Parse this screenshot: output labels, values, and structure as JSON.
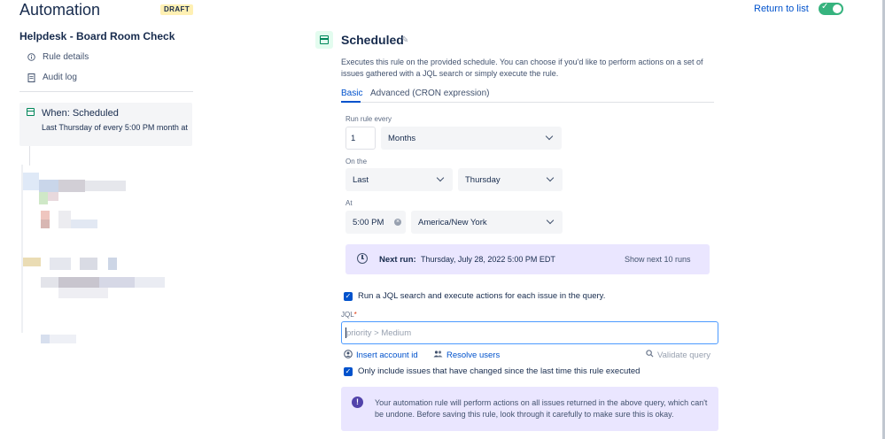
{
  "header": {
    "app_title": "Automation",
    "draft_badge": "DRAFT",
    "return_link": "Return to list",
    "toggle_state": "enabled"
  },
  "sidebar": {
    "rule_name": "Helpdesk - Board Room Check",
    "links": [
      {
        "label": "Rule details",
        "icon": "info-icon"
      },
      {
        "label": "Audit log",
        "icon": "document-icon"
      }
    ],
    "trigger": {
      "title": "When: Scheduled",
      "description": "Last Thursday of every 5:00 PM month at"
    }
  },
  "main": {
    "title": "Scheduled",
    "description": "Executes this rule on the provided schedule. You can choose if you'd like to perform actions on a set of issues gathered with a JQL search or simply execute the rule.",
    "tabs": [
      {
        "label": "Basic",
        "active": true
      },
      {
        "label": "Advanced (CRON expression)",
        "active": false
      }
    ],
    "schedule": {
      "run_every_label": "Run rule every",
      "run_every_value": "1",
      "run_every_unit": "Months",
      "on_the_label": "On the",
      "on_the_ordinal": "Last",
      "on_the_day": "Thursday",
      "at_label": "At",
      "at_time": "5:00 PM",
      "timezone": "America/New York"
    },
    "next_run": {
      "label": "Next run:",
      "value": "Thursday, July 28, 2022 5:00 PM EDT",
      "show_next": "Show next 10 runs"
    },
    "jql_checkbox": {
      "checked": true,
      "label": "Run a JQL search and execute actions for each issue in the query."
    },
    "jql": {
      "label": "JQL",
      "required_mark": "*",
      "placeholder": "priority > Medium",
      "value": ""
    },
    "jql_actions": {
      "insert_account": "Insert account id",
      "resolve_users": "Resolve users",
      "validate": "Validate query"
    },
    "only_changed_checkbox": {
      "checked": true,
      "label": "Only include issues that have changed since the last time this rule executed"
    },
    "warning": {
      "text": "Your automation rule will perform actions on all issues returned in the above query, which can't be undone. Before saving this rule, look through it carefully to make sure this is okay."
    }
  },
  "colors": {
    "brand_blue": "#0052cc",
    "toggle_green": "#36b37e",
    "schedule_green": "#00875a",
    "info_panel": "#eae6ff",
    "warning_icon": "#5243aa"
  }
}
